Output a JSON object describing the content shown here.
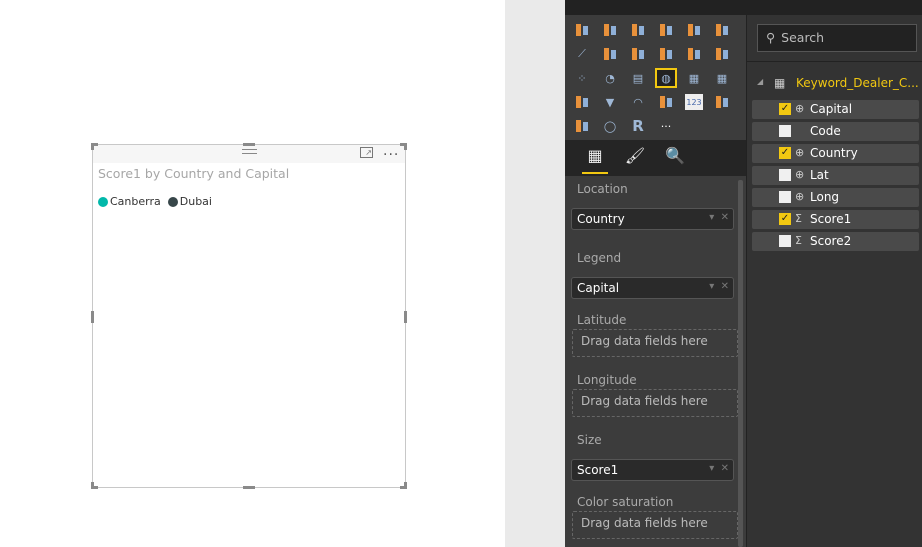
{
  "visual": {
    "title": "Score1 by Country and Capital",
    "legend": [
      {
        "label": "Canberra",
        "color": "#01b8aa"
      },
      {
        "label": "Dubai",
        "color": "#374649"
      }
    ],
    "focus_icon": "focus-mode-icon",
    "more_icon": "more-options-icon"
  },
  "visualizations": {
    "icons": [
      "stacked-bar",
      "stacked-column",
      "clustered-bar",
      "clustered-column",
      "100-stacked-bar",
      "100-stacked-column",
      "line",
      "area",
      "stacked-area",
      "line-column",
      "line-clustered-column",
      "ribbon",
      "scatter",
      "pie",
      "treemap",
      "map",
      "table",
      "matrix",
      "filled-map",
      "funnel",
      "gauge",
      "multi-row-card",
      "card",
      "kpi",
      "slicer",
      "donut",
      "r-script",
      "more"
    ],
    "selected": "map",
    "r_label": "R",
    "card_label": "123",
    "more_label": "...",
    "tabs": [
      "fields-tab",
      "format-tab",
      "analytics-tab"
    ],
    "wells": [
      {
        "label": "Location",
        "value": "Country"
      },
      {
        "label": "Legend",
        "value": "Capital"
      },
      {
        "label": "Latitude",
        "placeholder": "Drag data fields here"
      },
      {
        "label": "Longitude",
        "placeholder": "Drag data fields here"
      },
      {
        "label": "Size",
        "value": "Score1"
      },
      {
        "label": "Color saturation",
        "placeholder": "Drag data fields here"
      }
    ]
  },
  "fields": {
    "search_placeholder": "Search",
    "table": "Keyword_Dealer_C...",
    "items": [
      {
        "name": "Capital",
        "checked": true,
        "icon": "globe"
      },
      {
        "name": "Code",
        "checked": false,
        "icon": ""
      },
      {
        "name": "Country",
        "checked": true,
        "icon": "globe"
      },
      {
        "name": "Lat",
        "checked": false,
        "icon": "globe"
      },
      {
        "name": "Long",
        "checked": false,
        "icon": "globe"
      },
      {
        "name": "Score1",
        "checked": true,
        "icon": "sigma"
      },
      {
        "name": "Score2",
        "checked": false,
        "icon": "sigma"
      }
    ]
  },
  "colors": {
    "accent": "#f2c811"
  }
}
